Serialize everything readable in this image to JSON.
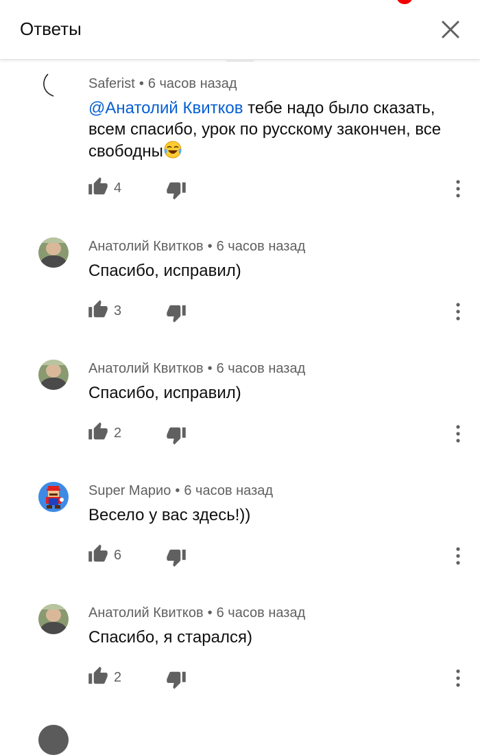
{
  "header": {
    "title": "Ответы",
    "close_icon": "close-icon"
  },
  "comments": [
    {
      "author": "Saferist",
      "time": "6 часов назад",
      "mention": "@Анатолий Квитков",
      "text": " тебе надо было сказать, всем спасибо, урок по русскому закончен, все свободны",
      "emoji": "face-with-tears-of-joy",
      "likes": "4"
    },
    {
      "author": "Анатолий Квитков",
      "time": "6 часов назад",
      "text": "Спасибо, исправил)",
      "likes": "3"
    },
    {
      "author": "Анатолий Квитков",
      "time": "6 часов назад",
      "text": "Спасибо, исправил)",
      "likes": "2"
    },
    {
      "author": "Super Марио",
      "time": "6 часов назад",
      "text": "Весело у вас здесь!))",
      "likes": "6"
    },
    {
      "author": "Анатолий Квитков",
      "time": "6 часов назад",
      "text": "Спасибо, я старался)",
      "likes": "2"
    }
  ],
  "icons": {
    "like": "thumbs-up-icon",
    "dislike": "thumbs-down-icon",
    "more": "more-vertical-icon"
  },
  "colors": {
    "mention": "#065fd4",
    "meta_text": "#606060",
    "icon": "#606060",
    "notification": "#f00000"
  }
}
